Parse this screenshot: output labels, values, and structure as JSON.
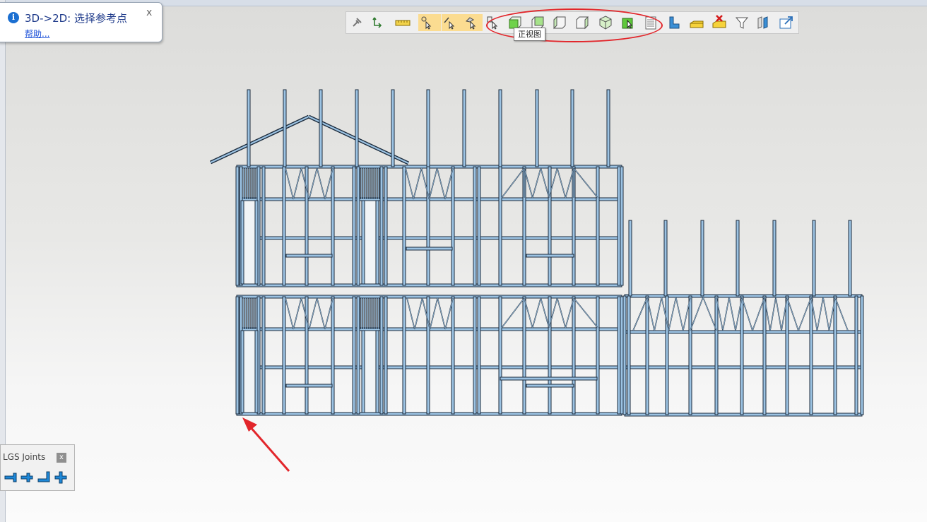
{
  "hint": {
    "title": "3D->2D: 选择参考点",
    "help": "帮助...",
    "close": "x"
  },
  "toolbar": {
    "buttons": [
      {
        "name": "pin-icon",
        "hl": false
      },
      {
        "name": "rotate-icon",
        "hl": false
      },
      {
        "name": "ruler-icon",
        "hl": false
      },
      {
        "name": "snap-point-icon",
        "hl": true
      },
      {
        "name": "snap-edge-icon",
        "hl": true
      },
      {
        "name": "snap-face-icon",
        "hl": true
      },
      {
        "name": "select-box-icon",
        "hl": false
      },
      {
        "name": "front-view-icon",
        "hl": false
      },
      {
        "name": "back-view-icon",
        "hl": false
      },
      {
        "name": "left-view-icon",
        "hl": false
      },
      {
        "name": "right-view-icon",
        "hl": false
      },
      {
        "name": "iso-view-icon",
        "hl": false
      },
      {
        "name": "select-view-icon",
        "hl": false
      },
      {
        "name": "layers-icon",
        "hl": false
      },
      {
        "name": "profile-icon",
        "hl": false
      },
      {
        "name": "stack-icon",
        "hl": false
      },
      {
        "name": "delete-stack-icon",
        "hl": false
      },
      {
        "name": "filter-icon",
        "hl": false
      },
      {
        "name": "panels-icon",
        "hl": false
      },
      {
        "name": "export-icon",
        "hl": false
      }
    ]
  },
  "tooltip": "正视图",
  "joints_panel": {
    "title": "LGS Joints",
    "close": "x",
    "buttons": [
      "t-joint-left-icon",
      "t-joint-right-icon",
      "l-joint-icon",
      "cross-joint-icon"
    ]
  },
  "colors": {
    "accent_red": "#e2262b",
    "steel_fill": "#9cc3e3",
    "steel_dark": "#1c2b3c",
    "highlight": "#fbdc91"
  }
}
